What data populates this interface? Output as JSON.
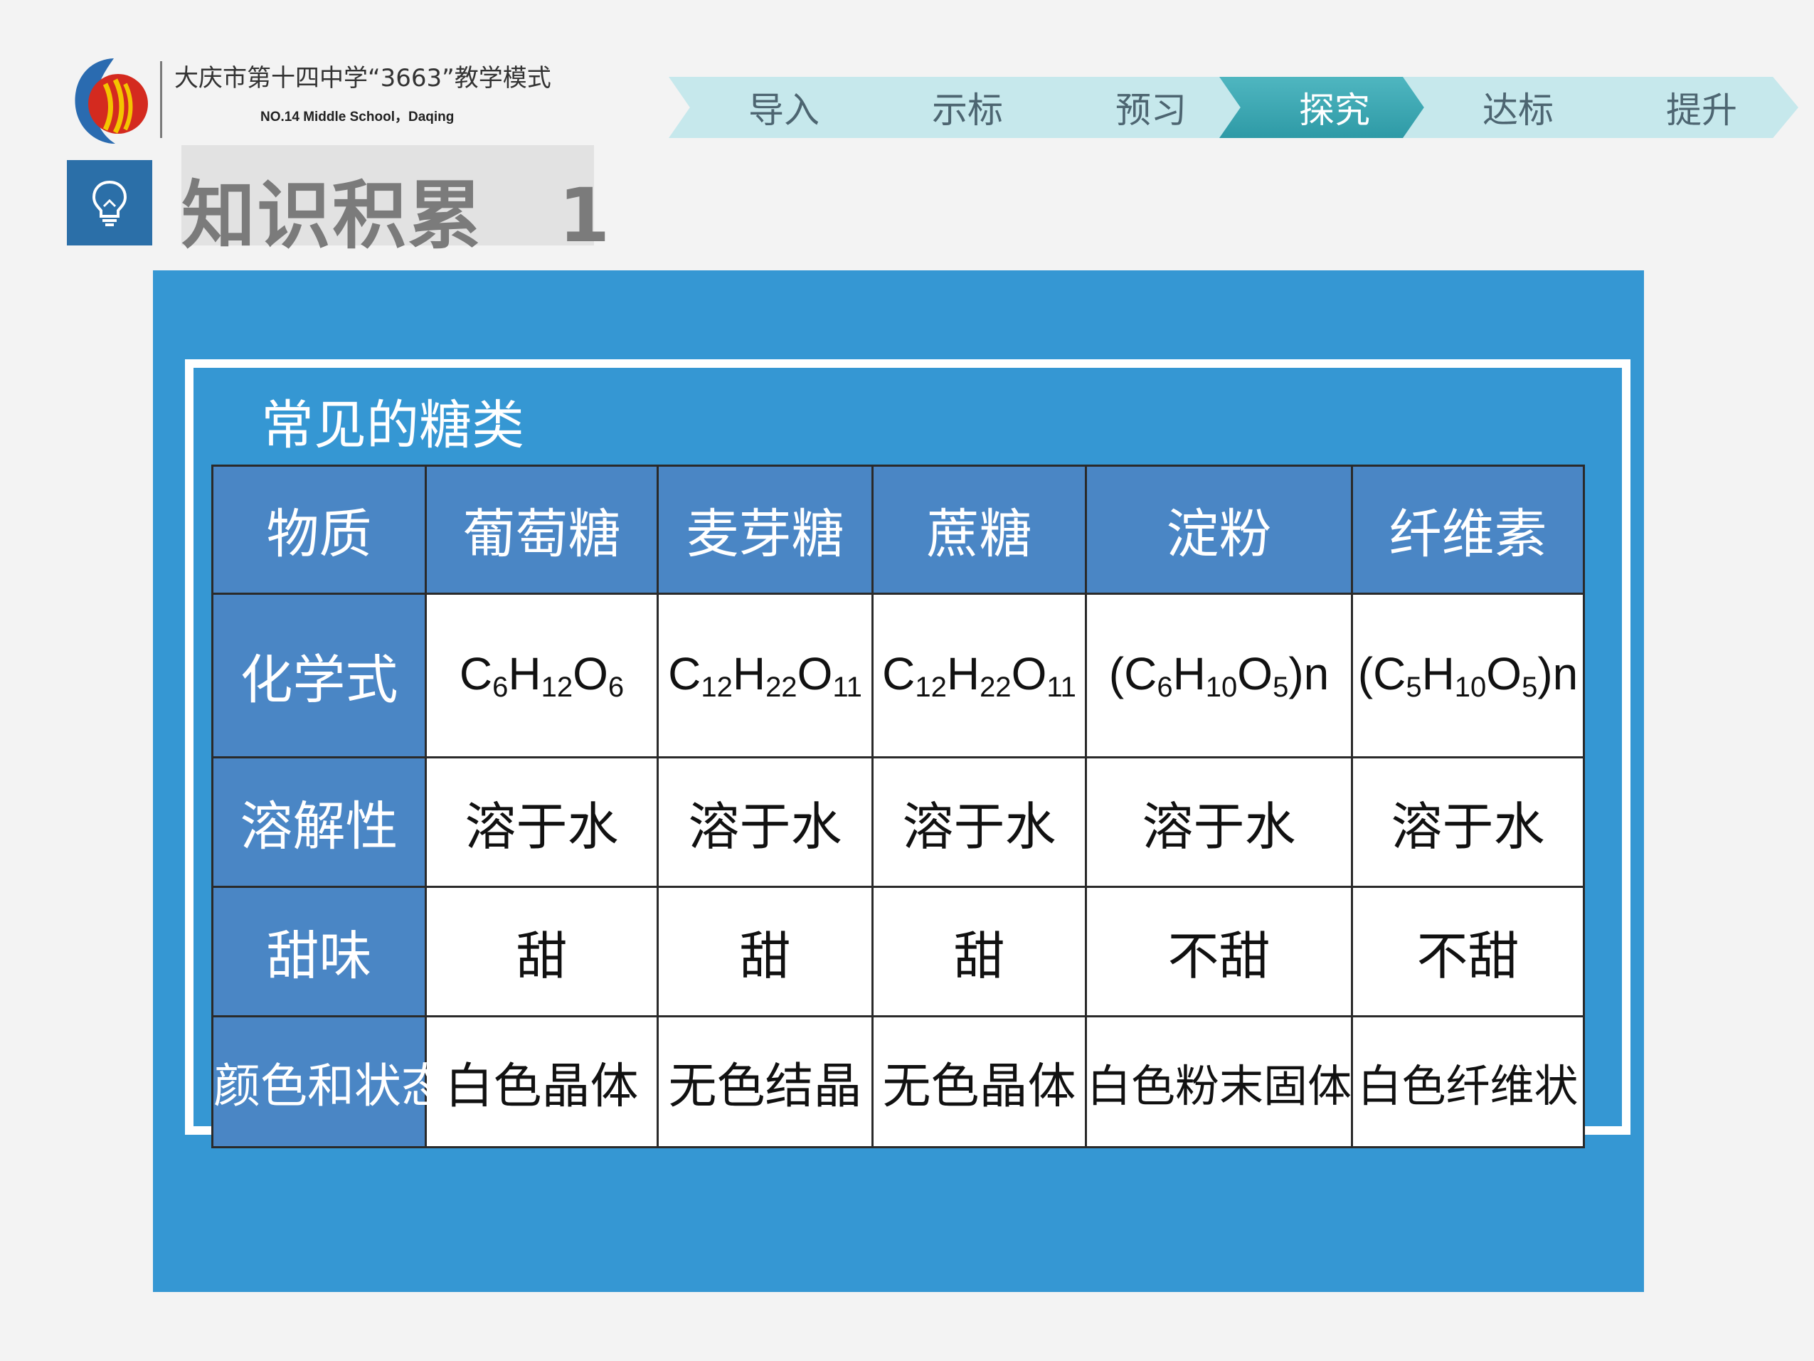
{
  "header": {
    "school_title": "大庆市第十四中学“3663”教学模式",
    "school_subtitle": "NO.14 Middle School，Daqing"
  },
  "nav": {
    "items": [
      {
        "label": "导入",
        "active": false
      },
      {
        "label": "示标",
        "active": false
      },
      {
        "label": "预习",
        "active": false
      },
      {
        "label": "探究",
        "active": true
      },
      {
        "label": "达标",
        "active": false
      },
      {
        "label": "提升",
        "active": false
      }
    ]
  },
  "section": {
    "title": "知识积累　1",
    "icon": "lightbulb-icon"
  },
  "panel": {
    "caption": "常见的糖类"
  },
  "table": {
    "header_label": "物质",
    "columns": [
      "葡萄糖",
      "麦芽糖",
      "蔗糖",
      "淀粉",
      "纤维素"
    ],
    "formulas": [
      {
        "parts": [
          "C",
          "6",
          "H",
          "12",
          "O",
          "6",
          ""
        ]
      },
      {
        "parts": [
          "C",
          "12",
          "H",
          "22",
          "O",
          "11",
          ""
        ]
      },
      {
        "parts": [
          "C",
          "12",
          "H",
          "22",
          "O",
          "11",
          ""
        ]
      },
      {
        "parts": [
          "(C",
          "6",
          "H",
          "10",
          "O",
          "5",
          ")n"
        ]
      },
      {
        "parts": [
          "(C",
          "5",
          "H",
          "10",
          "O",
          "5",
          ")n"
        ]
      }
    ],
    "rows": {
      "formula_label": "化学式",
      "solubility_label": "溶解性",
      "solubility": [
        "溶于水",
        "溶于水",
        "溶于水",
        "溶于水",
        "溶于水"
      ],
      "sweet_label": "甜味",
      "sweet": [
        "甜",
        "甜",
        "甜",
        "不甜",
        "不甜"
      ],
      "color_label": "颜色和状态",
      "color": [
        "白色晶体",
        "无色结晶",
        "无色晶体",
        "白色粉末固体",
        "白色纤维状"
      ]
    }
  },
  "colors": {
    "panel_blue": "#3597d3",
    "table_header_blue": "#4a86c5",
    "nav_active": "#2e9aa6",
    "nav_inactive": "#c6e8ec",
    "section_icon_bg": "#2b6fa8"
  }
}
